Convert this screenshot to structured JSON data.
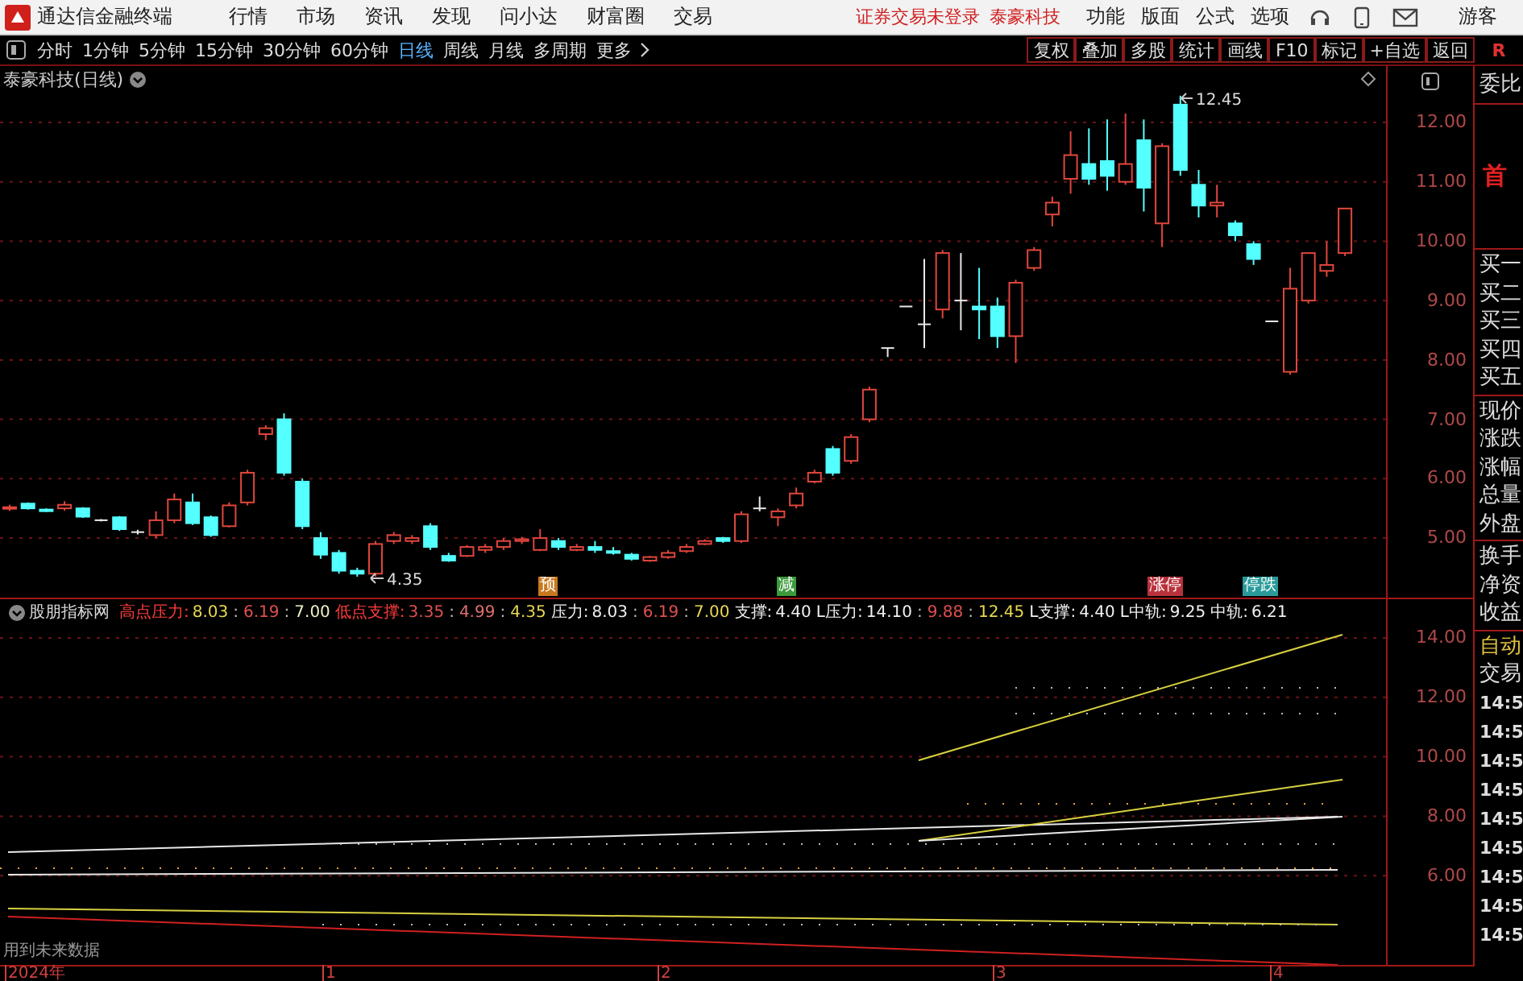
{
  "menu_bar": {
    "app_title": "通达信金融终端",
    "menus": [
      "行情",
      "市场",
      "资讯",
      "发现",
      "问小达",
      "财富圈",
      "交易"
    ],
    "login_status": "证券交易未登录",
    "stock_name": "泰豪科技",
    "tools": [
      "功能",
      "版面",
      "公式",
      "选项"
    ],
    "user": "游客"
  },
  "period_bar": {
    "periods": [
      {
        "label": "分时",
        "selected": false
      },
      {
        "label": "1分钟",
        "selected": false
      },
      {
        "label": "5分钟",
        "selected": false
      },
      {
        "label": "15分钟",
        "selected": false
      },
      {
        "label": "30分钟",
        "selected": false
      },
      {
        "label": "60分钟",
        "selected": false
      },
      {
        "label": "日线",
        "selected": true
      },
      {
        "label": "周线",
        "selected": false
      },
      {
        "label": "月线",
        "selected": false
      },
      {
        "label": "多周期",
        "selected": false
      }
    ],
    "more": "更多",
    "buttons": [
      "复权",
      "叠加",
      "多股",
      "统计",
      "画线",
      "F10",
      "标记",
      "+自选",
      "返回"
    ],
    "flag": "R"
  },
  "main_chart": {
    "title": "泰豪科技(日线)",
    "y_axis_labels": [
      "12.00",
      "11.00",
      "10.00",
      "9.00",
      "8.00",
      "7.00",
      "6.00",
      "5.00"
    ],
    "high_label": "12.45",
    "low_label": "4.35",
    "signals": [
      {
        "text": "预",
        "color": "#c8781e"
      },
      {
        "text": "减",
        "color": "#3c9a3c"
      },
      {
        "text": "涨停",
        "color": "#b8323c"
      },
      {
        "text": "停跌",
        "color": "#2a9a9a"
      }
    ]
  },
  "indicator": {
    "name": "股朋指标网",
    "legend": [
      {
        "label": "高点压力:",
        "color": "#ff3c3c",
        "values": [
          {
            "text": "8.03",
            "color": "#e8d850"
          },
          {
            "text": "6.19",
            "color": "#e05050"
          },
          {
            "text": "7.00",
            "color": "#f0f0c0"
          }
        ]
      },
      {
        "label": "低点支撑:",
        "color": "#ff3c3c",
        "values": [
          {
            "text": "3.35",
            "color": "#e05050"
          },
          {
            "text": "4.99",
            "color": "#e07070"
          },
          {
            "text": "4.35",
            "color": "#e8d850"
          }
        ]
      },
      {
        "label": "压力:",
        "color": "#f0f0f0",
        "values": [
          {
            "text": "8.03",
            "color": "#f0f0f0"
          },
          {
            "text": "6.19",
            "color": "#e05050"
          },
          {
            "text": "7.00",
            "color": "#e8d850"
          }
        ]
      },
      {
        "label": "支撑:",
        "color": "#f0f0f0",
        "values": [
          {
            "text": "4.40",
            "color": "#f0f0f0"
          }
        ]
      },
      {
        "label": "L压力:",
        "color": "#f0f0f0",
        "values": [
          {
            "text": "14.10",
            "color": "#f0f0f0"
          },
          {
            "text": "9.88",
            "color": "#e05050"
          },
          {
            "text": "12.45",
            "color": "#e8d850"
          }
        ]
      },
      {
        "label": "L支撑:",
        "color": "#f0f0f0",
        "values": [
          {
            "text": "4.40",
            "color": "#f0f0f0"
          }
        ]
      },
      {
        "label": "L中轨:",
        "color": "#f0f0f0",
        "values": [
          {
            "text": "9.25",
            "color": "#f0f0f0"
          }
        ]
      },
      {
        "label": "中轨:",
        "color": "#f0f0f0",
        "values": [
          {
            "text": "6.21",
            "color": "#f0f0f0"
          }
        ]
      }
    ],
    "separator": ":",
    "y_axis_labels": [
      "14.00",
      "12.00",
      "10.00",
      "8.00",
      "6.00"
    ],
    "note": "用到未来数据"
  },
  "x_axis": {
    "labels": [
      "2024年",
      "1",
      "2",
      "3",
      "4"
    ]
  },
  "quote_panel": {
    "header": "委比",
    "badge": "首",
    "bid_rows": [
      "买一",
      "买二",
      "买三",
      "买四",
      "买五"
    ],
    "price_rows": [
      "现价",
      "涨跌",
      "涨幅",
      "总量",
      "外盘"
    ],
    "other_rows": [
      "换手",
      "净资",
      "收益"
    ],
    "mode": "自动",
    "trades_title": "交易",
    "trade_times": [
      "14:5",
      "14:5",
      "14:5",
      "14:5",
      "14:5",
      "14:5",
      "14:5",
      "14:5",
      "14:5"
    ]
  }
}
